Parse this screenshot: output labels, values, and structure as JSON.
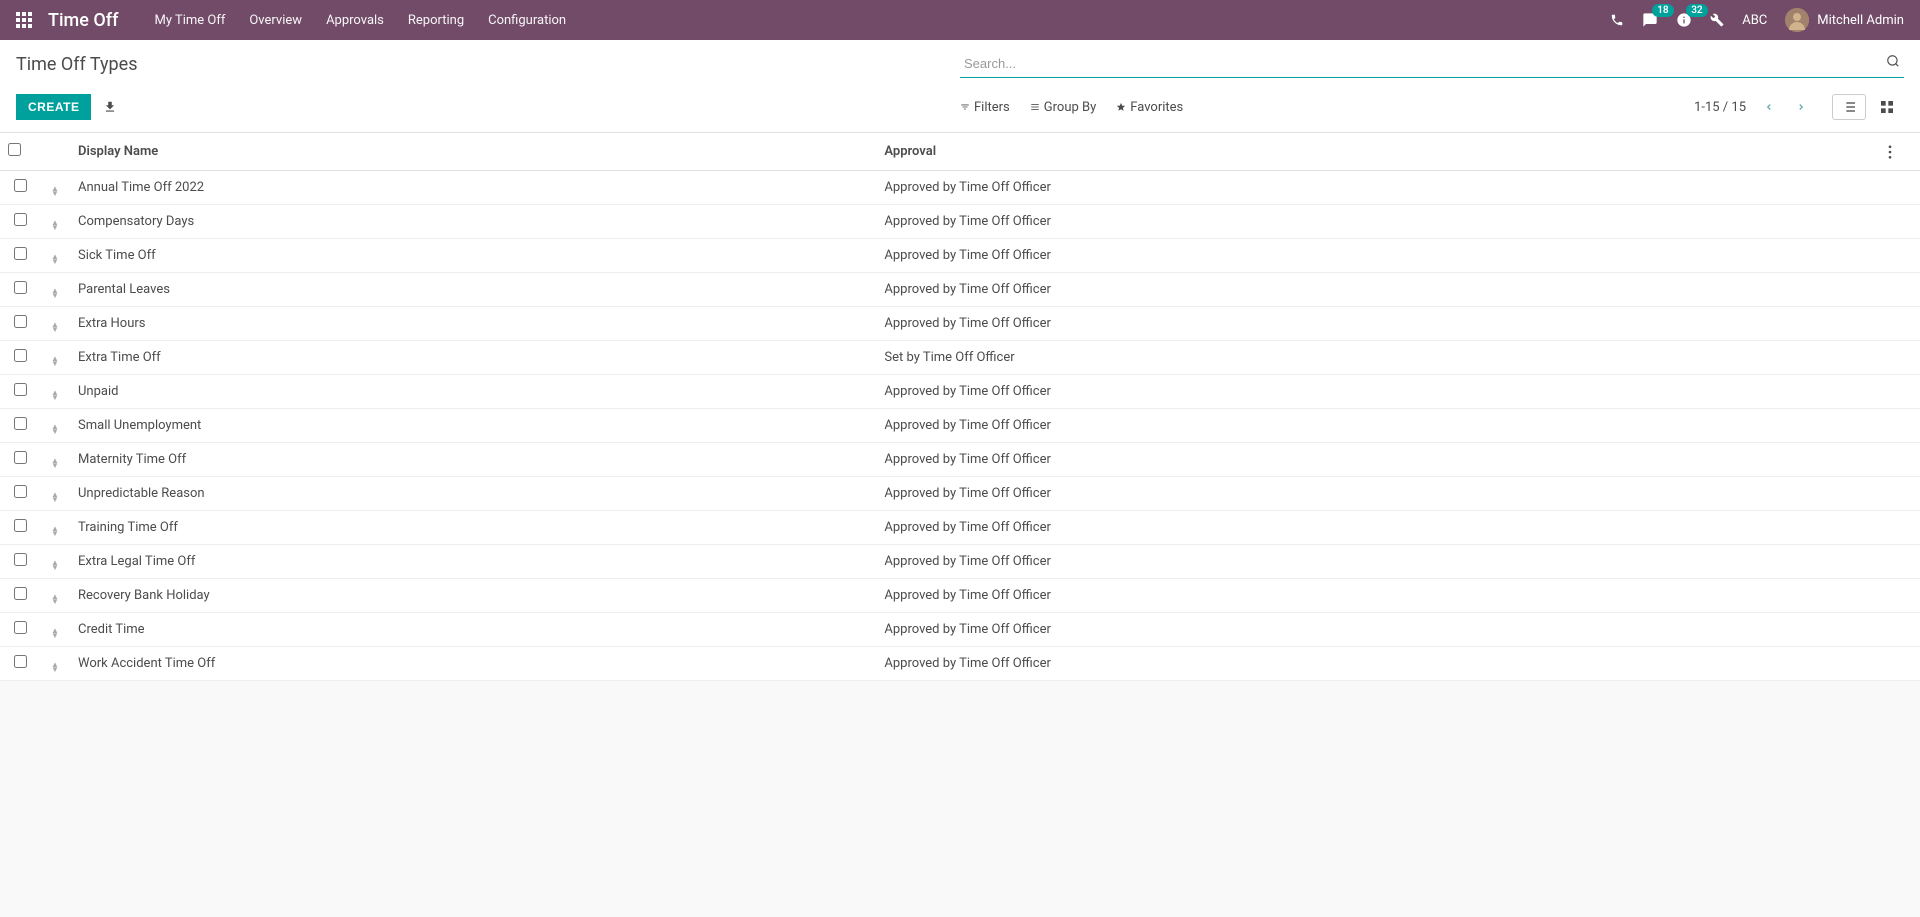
{
  "navbar": {
    "app_title": "Time Off",
    "menu": [
      "My Time Off",
      "Overview",
      "Approvals",
      "Reporting",
      "Configuration"
    ],
    "messages_badge": "18",
    "activities_badge": "32",
    "company": "ABC",
    "user": "Mitchell Admin"
  },
  "breadcrumb": {
    "title": "Time Off Types"
  },
  "search": {
    "placeholder": "Search..."
  },
  "buttons": {
    "create": "CREATE"
  },
  "search_options": {
    "filters": "Filters",
    "group_by": "Group By",
    "favorites": "Favorites"
  },
  "pager": {
    "text": "1-15 / 15"
  },
  "columns": {
    "display_name": "Display Name",
    "approval": "Approval"
  },
  "rows": [
    {
      "name": "Annual Time Off 2022",
      "approval": "Approved by Time Off Officer"
    },
    {
      "name": "Compensatory Days",
      "approval": "Approved by Time Off Officer"
    },
    {
      "name": "Sick Time Off",
      "approval": "Approved by Time Off Officer"
    },
    {
      "name": "Parental Leaves",
      "approval": "Approved by Time Off Officer"
    },
    {
      "name": "Extra Hours",
      "approval": "Approved by Time Off Officer"
    },
    {
      "name": "Extra Time Off",
      "approval": "Set by Time Off Officer"
    },
    {
      "name": "Unpaid",
      "approval": "Approved by Time Off Officer"
    },
    {
      "name": "Small Unemployment",
      "approval": "Approved by Time Off Officer"
    },
    {
      "name": "Maternity Time Off",
      "approval": "Approved by Time Off Officer"
    },
    {
      "name": "Unpredictable Reason",
      "approval": "Approved by Time Off Officer"
    },
    {
      "name": "Training Time Off",
      "approval": "Approved by Time Off Officer"
    },
    {
      "name": "Extra Legal Time Off",
      "approval": "Approved by Time Off Officer"
    },
    {
      "name": "Recovery Bank Holiday",
      "approval": "Approved by Time Off Officer"
    },
    {
      "name": "Credit Time",
      "approval": "Approved by Time Off Officer"
    },
    {
      "name": "Work Accident Time Off",
      "approval": "Approved by Time Off Officer"
    }
  ]
}
